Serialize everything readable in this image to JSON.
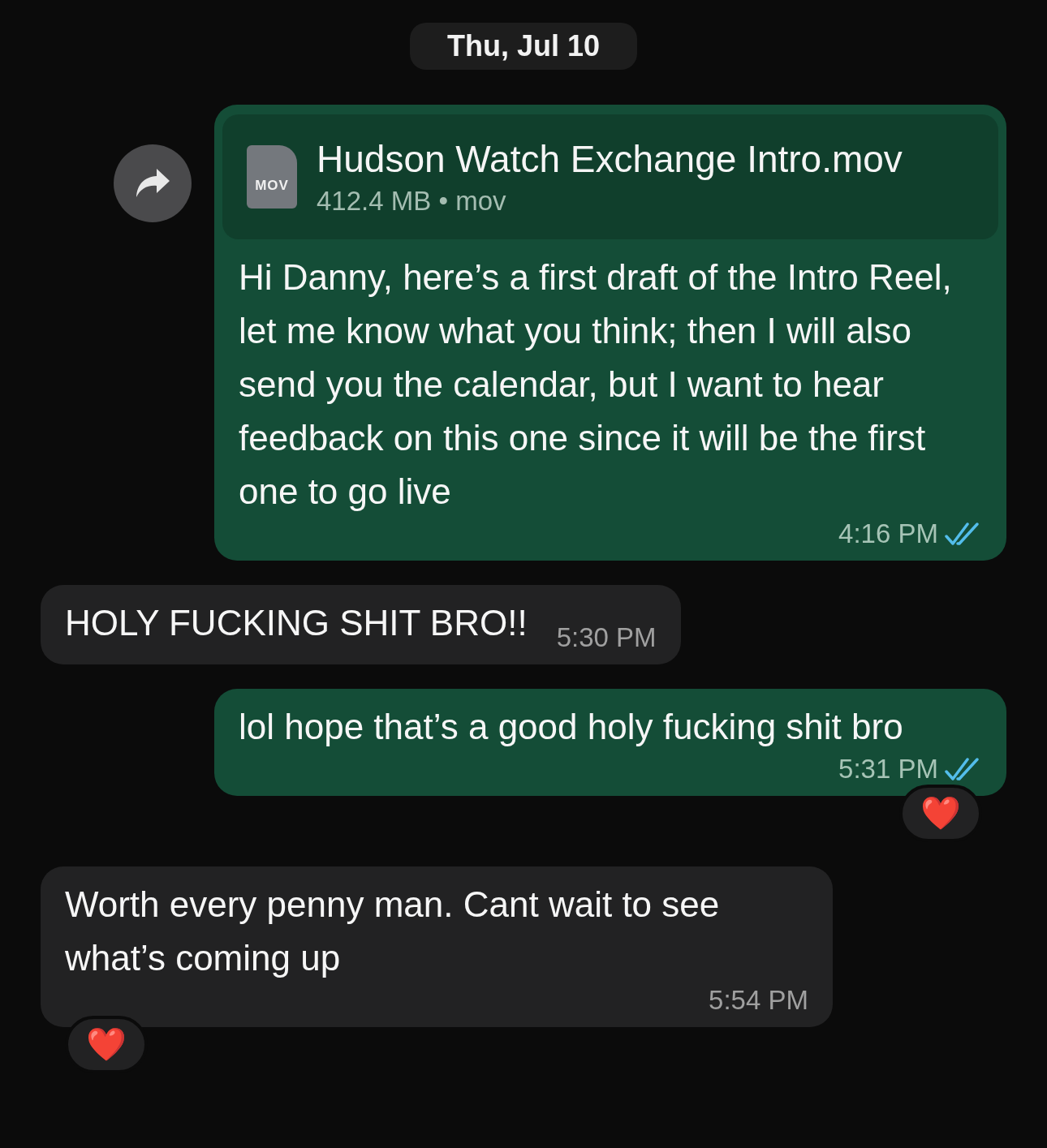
{
  "date_separator": "Thu, Jul 10",
  "messages": [
    {
      "outgoing": true,
      "kind": "file",
      "forward_button": true,
      "file": {
        "type_label": "MOV",
        "name": "Hudson Watch Exchange Intro.mov",
        "meta": "412.4 MB • mov"
      },
      "text": "Hi Danny, here’s a first draft of the Intro Reel, let me know what you think; then I will also send you the calendar, but I want to hear feedback on this one since it will be the first one to go live",
      "time": "4:16 PM",
      "read": true
    },
    {
      "outgoing": false,
      "kind": "text",
      "text": "HOLY FUCKING SHIT BRO!!",
      "time": "5:30 PM"
    },
    {
      "outgoing": true,
      "kind": "text",
      "text": "lol hope that’s a good holy fucking shit bro",
      "time": "5:31 PM",
      "read": true,
      "reaction": "❤️"
    },
    {
      "outgoing": false,
      "kind": "text",
      "text": "Worth every penny man. Cant wait to see what’s coming up",
      "time": "5:54 PM",
      "reaction": "❤️"
    }
  ]
}
